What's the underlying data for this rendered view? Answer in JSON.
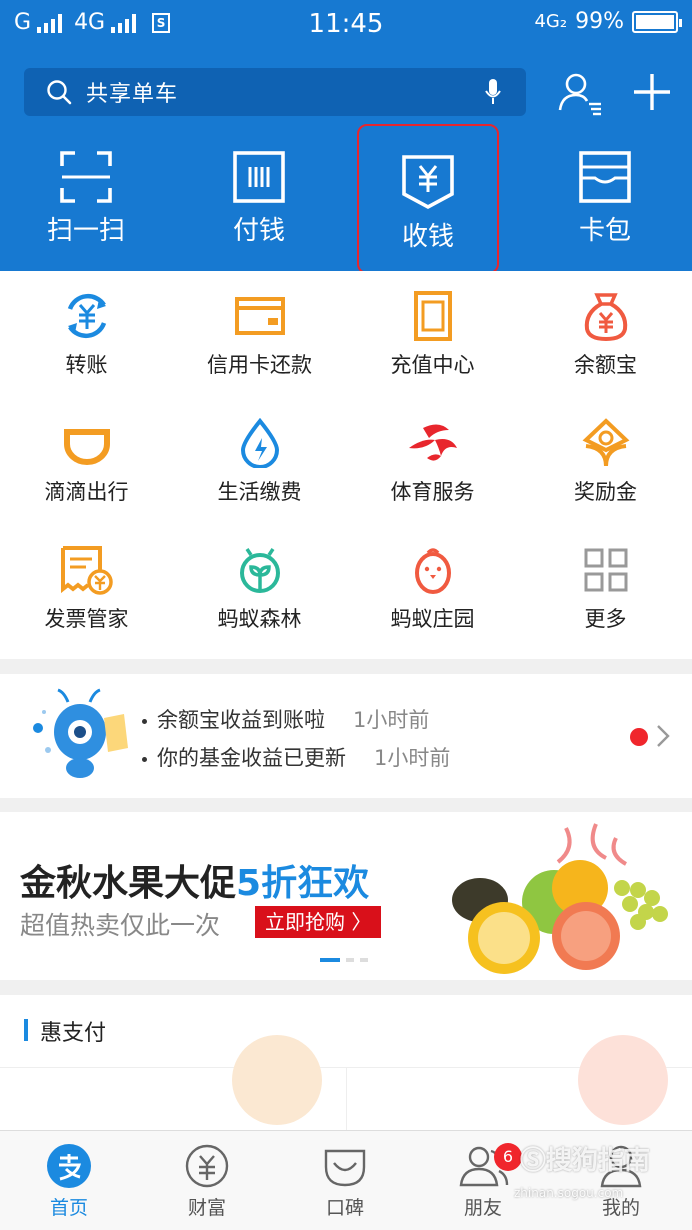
{
  "status": {
    "carrier1": "G",
    "carrier2": "4G",
    "sim_badge": "S",
    "time": "11:45",
    "network": "4G₂",
    "battery": "99%",
    "battery_level": 0.99
  },
  "header": {
    "search_label": "共享单车",
    "actions": [
      {
        "label": "扫一扫",
        "icon": "scan-icon"
      },
      {
        "label": "付钱",
        "icon": "barcode-icon"
      },
      {
        "label": "收钱",
        "icon": "receive-money-icon"
      },
      {
        "label": "卡包",
        "icon": "card-wallet-icon"
      }
    ]
  },
  "grid": [
    {
      "label": "转账",
      "icon": "transfer-icon",
      "color": "#1b8ae0"
    },
    {
      "label": "信用卡还款",
      "icon": "credit-card-icon",
      "color": "#f39c22"
    },
    {
      "label": "充值中心",
      "icon": "phone-topup-icon",
      "color": "#f39c22"
    },
    {
      "label": "余额宝",
      "icon": "money-bag-icon",
      "color": "#f05a40"
    },
    {
      "label": "滴滴出行",
      "icon": "didi-icon",
      "color": "#f39c22"
    },
    {
      "label": "生活缴费",
      "icon": "water-drop-icon",
      "color": "#1b8ae0"
    },
    {
      "label": "体育服务",
      "icon": "sports-icon",
      "color": "#e8262d"
    },
    {
      "label": "奖励金",
      "icon": "reward-icon",
      "color": "#f39c22"
    },
    {
      "label": "发票管家",
      "icon": "invoice-icon",
      "color": "#f39c22"
    },
    {
      "label": "蚂蚁森林",
      "icon": "sprout-icon",
      "color": "#2bb89a"
    },
    {
      "label": "蚂蚁庄园",
      "icon": "chick-icon",
      "color": "#f05a40"
    },
    {
      "label": "更多",
      "icon": "more-grid-icon",
      "color": "#999999"
    }
  ],
  "news": {
    "items": [
      {
        "text": "余额宝收益到账啦",
        "time": "1小时前"
      },
      {
        "text": "你的基金收益已更新",
        "time": "1小时前"
      }
    ]
  },
  "banner": {
    "title": "金秋水果大促",
    "title_highlight": "5折狂欢",
    "subtitle": "超值热卖仅此一次",
    "cta": "立即抢购 〉"
  },
  "hui": {
    "title": "惠支付"
  },
  "tabs": [
    {
      "label": "首页",
      "icon": "alipay-home-icon",
      "active": true
    },
    {
      "label": "财富",
      "icon": "wealth-icon"
    },
    {
      "label": "口碑",
      "icon": "koubei-icon"
    },
    {
      "label": "朋友",
      "icon": "friends-icon",
      "badge": "6"
    },
    {
      "label": "我的",
      "icon": "profile-icon"
    }
  ],
  "watermark": {
    "text": "搜狗指南",
    "url_text": "zhinan.sogou.com"
  }
}
